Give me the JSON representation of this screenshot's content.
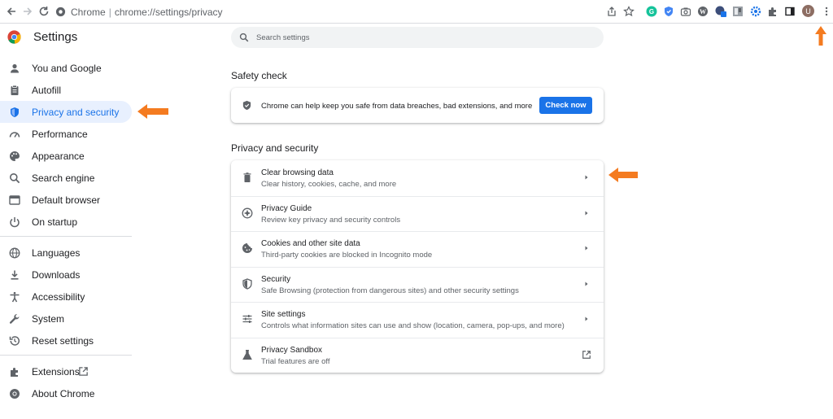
{
  "browser": {
    "site_name": "Chrome",
    "url": "chrome://settings/privacy",
    "profile_initial": "U"
  },
  "sidebar": {
    "title": "Settings",
    "items": [
      {
        "label": "You and Google",
        "icon": "person-icon"
      },
      {
        "label": "Autofill",
        "icon": "clipboard-icon"
      },
      {
        "label": "Privacy and security",
        "icon": "shield-icon",
        "active": true
      },
      {
        "label": "Performance",
        "icon": "speedometer-icon"
      },
      {
        "label": "Appearance",
        "icon": "palette-icon"
      },
      {
        "label": "Search engine",
        "icon": "search-icon"
      },
      {
        "label": "Default browser",
        "icon": "browser-window-icon"
      },
      {
        "label": "On startup",
        "icon": "power-icon"
      },
      {
        "label": "Languages",
        "icon": "globe-icon"
      },
      {
        "label": "Downloads",
        "icon": "download-icon"
      },
      {
        "label": "Accessibility",
        "icon": "accessibility-icon"
      },
      {
        "label": "System",
        "icon": "wrench-icon"
      },
      {
        "label": "Reset settings",
        "icon": "history-icon"
      },
      {
        "label": "Extensions",
        "icon": "puzzle-icon"
      },
      {
        "label": "About Chrome",
        "icon": "chrome-icon"
      }
    ]
  },
  "search": {
    "placeholder": "Search settings"
  },
  "safety_check": {
    "title": "Safety check",
    "text": "Chrome can help keep you safe from data breaches, bad extensions, and more",
    "button_label": "Check now"
  },
  "privacy": {
    "title": "Privacy and security",
    "rows": [
      {
        "title": "Clear browsing data",
        "subtitle": "Clear history, cookies, cache, and more",
        "icon": "trash-icon"
      },
      {
        "title": "Privacy Guide",
        "subtitle": "Review key privacy and security controls",
        "icon": "compass-icon"
      },
      {
        "title": "Cookies and other site data",
        "subtitle": "Third-party cookies are blocked in Incognito mode",
        "icon": "cookie-icon"
      },
      {
        "title": "Security",
        "subtitle": "Safe Browsing (protection from dangerous sites) and other security settings",
        "icon": "shield-icon"
      },
      {
        "title": "Site settings",
        "subtitle": "Controls what information sites can use and show (location, camera, pop-ups, and more)",
        "icon": "sliders-icon"
      },
      {
        "title": "Privacy Sandbox",
        "subtitle": "Trial features are off",
        "icon": "flask-icon"
      }
    ]
  },
  "colors": {
    "accent": "#1a73e8",
    "active_bg": "#e8f0fe",
    "annotation_arrow": "#f47b20"
  }
}
